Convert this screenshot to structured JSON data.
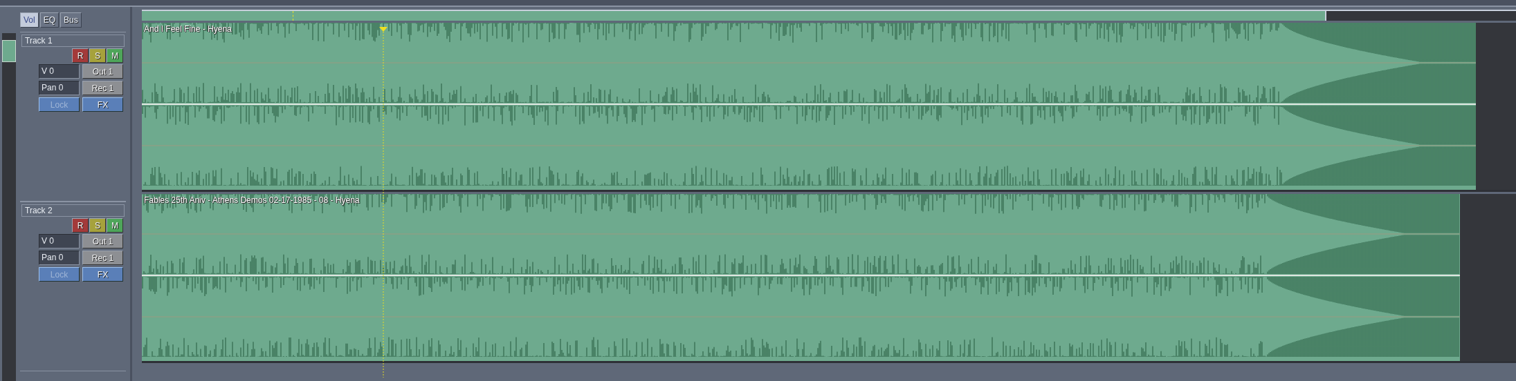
{
  "mixer_tabs": [
    {
      "label": "Vol",
      "selected": true
    },
    {
      "label": "EQ",
      "selected": false
    },
    {
      "label": "Bus",
      "selected": false
    }
  ],
  "tracks": [
    {
      "name": "Track 1",
      "buttons": [
        {
          "kind": "record",
          "label": "R"
        },
        {
          "kind": "solo",
          "label": "S"
        },
        {
          "kind": "mute",
          "label": "M"
        }
      ],
      "volume": "V 0",
      "output": "Out 1",
      "pan": "Pan 0",
      "input": "Rec 1",
      "lock": {
        "label": "Lock",
        "disabled": true
      },
      "fx": "FX",
      "clip": {
        "title": "And I Feel Fine - Hyena"
      }
    },
    {
      "name": "Track 2",
      "buttons": [
        {
          "kind": "record",
          "label": "R"
        },
        {
          "kind": "solo",
          "label": "S"
        },
        {
          "kind": "mute",
          "label": "M"
        }
      ],
      "volume": "V 0",
      "output": "Out 1",
      "pan": "Pan 0",
      "input": "Rec 1",
      "lock": {
        "label": "Lock",
        "disabled": true
      },
      "fx": "FX",
      "clip": {
        "title": "Fables 25th Aniv - Athens Demos 02-17-1985 - 08 - Hyena"
      }
    }
  ]
}
